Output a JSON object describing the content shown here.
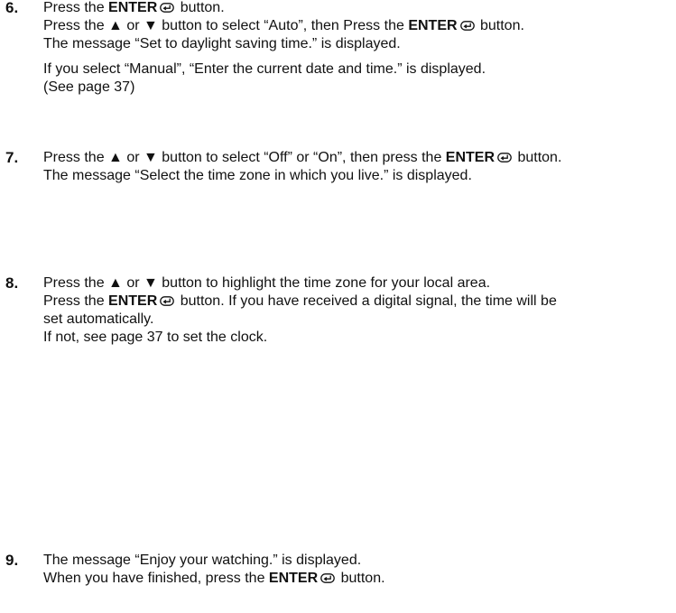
{
  "steps": [
    {
      "number": "6.",
      "lines": [
        [
          "Press the ",
          {
            "b": "ENTER"
          },
          {
            "icon": "enter-icon"
          },
          " button."
        ],
        [
          "Press the ▲ or ▼ button to select “Auto”, then Press the ",
          {
            "b": "ENTER"
          },
          {
            "icon": "enter-icon"
          },
          " button."
        ],
        [
          "The message “Set to daylight saving time.” is displayed."
        ],
        {
          "gap": true
        },
        [
          "If you select “Manual”, “Enter the current date and time.” is displayed."
        ],
        [
          "(See page 37)"
        ]
      ]
    },
    {
      "number": "7.",
      "lines": [
        [
          "Press the ▲ or ▼ button to select “Off” or “On”, then press the ",
          {
            "b": "ENTER"
          },
          {
            "icon": "enter-icon"
          },
          " button."
        ],
        [
          "The message “Select the time zone in which you live.” is displayed."
        ]
      ]
    },
    {
      "number": "8.",
      "lines": [
        [
          "Press the ▲ or ▼ button to highlight the time zone for your local area."
        ],
        [
          "Press the ",
          {
            "b": "ENTER"
          },
          {
            "icon": "enter-icon"
          },
          " button. If you have received a digital signal, the time will be"
        ],
        [
          "set automatically."
        ],
        [
          "If not, see page 37 to set the clock."
        ]
      ]
    },
    {
      "number": "9.",
      "lines": [
        [
          "The message “Enjoy your watching.” is displayed."
        ],
        [
          "When you have finished, press the ",
          {
            "b": "ENTER"
          },
          {
            "icon": "enter-icon"
          },
          " button."
        ]
      ]
    }
  ]
}
